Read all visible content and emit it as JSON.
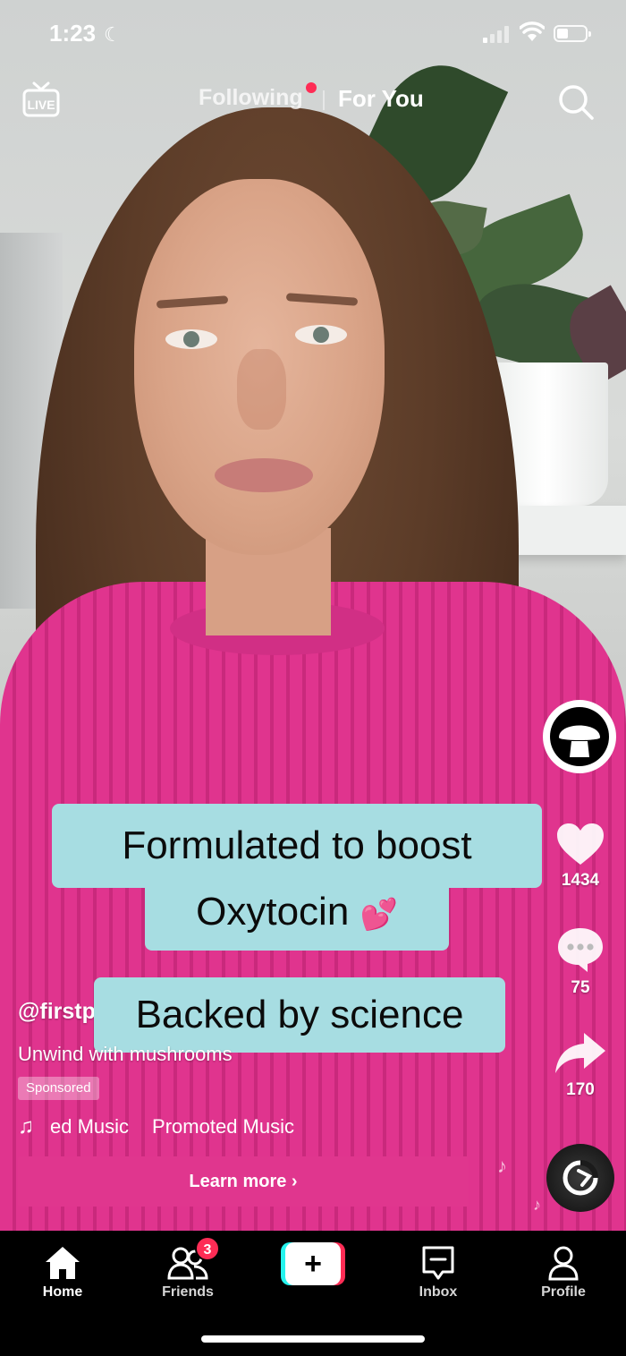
{
  "status_bar": {
    "time": "1:23",
    "battery_level": 0.4
  },
  "top_nav": {
    "live_label": "LIVE",
    "following_label": "Following",
    "for_you_label": "For You"
  },
  "captions": {
    "line1": "Formulated to boost",
    "line2": "Oxytocin",
    "line2_emoji": "💕",
    "line3": "Backed by science"
  },
  "right_rail": {
    "likes": "1434",
    "comments": "75",
    "shares": "170"
  },
  "post": {
    "handle": "@firstperson",
    "description": "Unwind with mushrooms",
    "sponsored_label": "Sponsored",
    "music_scroll_1": "ed Music",
    "music_scroll_2": "Promoted Music",
    "cta_label": "Learn more ›"
  },
  "bottom_nav": {
    "home": "Home",
    "friends": "Friends",
    "friends_badge": "3",
    "create": "+",
    "inbox": "Inbox",
    "profile": "Profile"
  },
  "colors": {
    "accent_red": "#fe2c55",
    "accent_cyan": "#25f4ee",
    "caption_bg": "#a7dde2",
    "cta_pink": "#e0368e"
  },
  "icons": [
    "moon-icon",
    "signal-icon",
    "wifi-icon",
    "battery-icon",
    "live-icon",
    "search-icon",
    "heart-icon",
    "comment-icon",
    "share-icon",
    "music-note-icon",
    "music-disc-icon",
    "home-icon",
    "friends-icon",
    "inbox-icon",
    "profile-icon"
  ]
}
